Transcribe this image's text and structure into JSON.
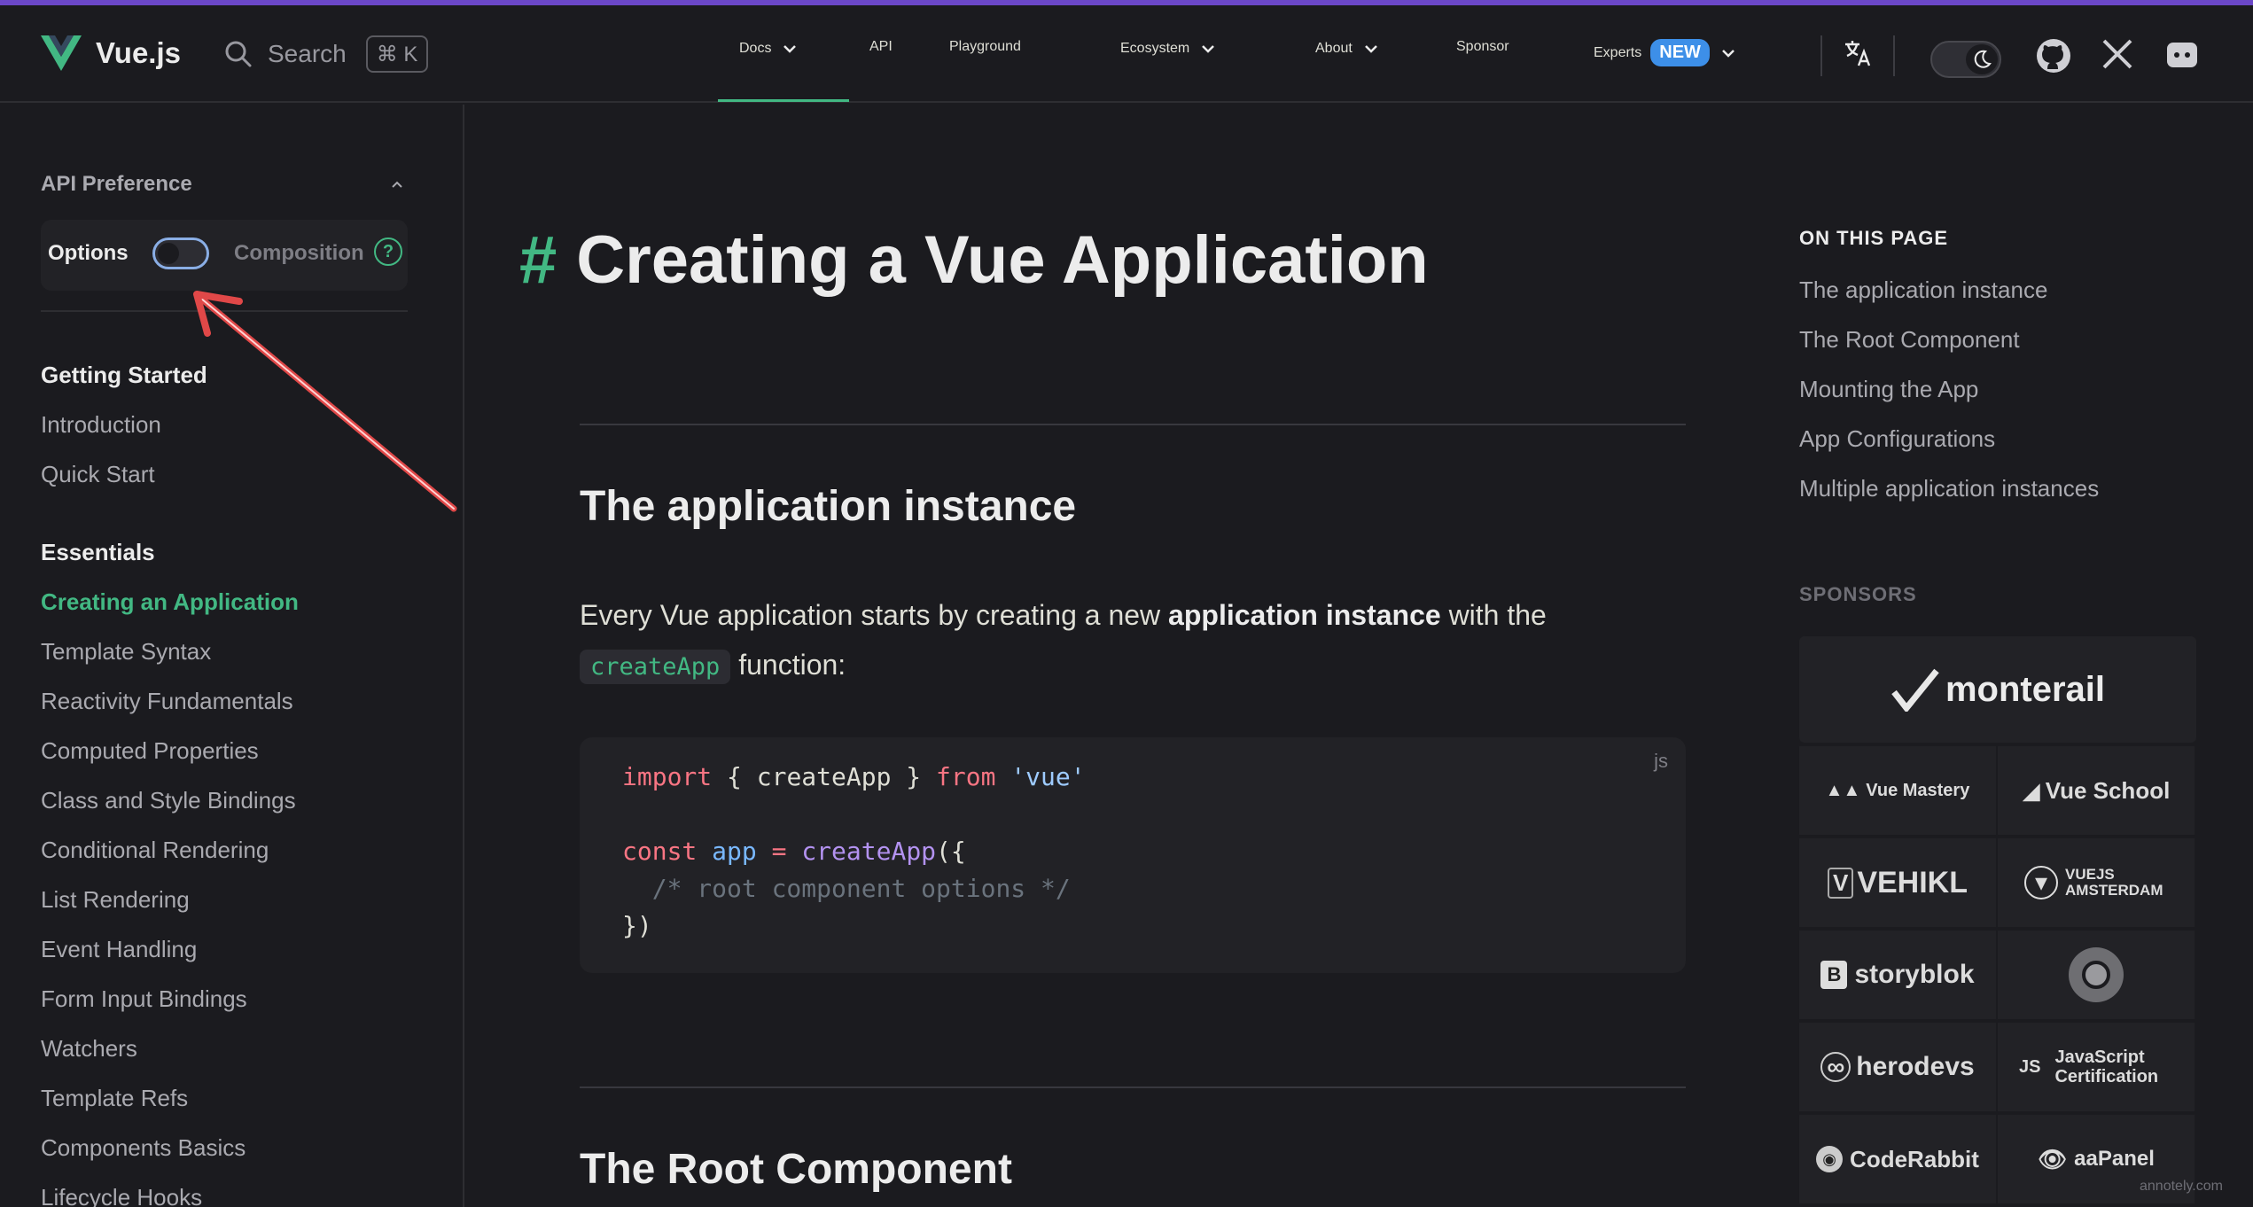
{
  "brand": {
    "name": "Vue.js",
    "accent": "#42b883",
    "top_line_color": "#6b47c8"
  },
  "search": {
    "label": "Search",
    "shortcut": "⌘ K"
  },
  "nav": {
    "docs": "Docs",
    "api": "API",
    "playground": "Playground",
    "ecosystem": "Ecosystem",
    "about": "About",
    "sponsor": "Sponsor",
    "experts": "Experts",
    "new_badge": "NEW"
  },
  "sidebar": {
    "api_preference": "API Preference",
    "options": "Options",
    "composition": "Composition",
    "help": "?",
    "sections": [
      {
        "title": "Getting Started",
        "items": [
          "Introduction",
          "Quick Start"
        ]
      },
      {
        "title": "Essentials",
        "items": [
          "Creating an Application",
          "Template Syntax",
          "Reactivity Fundamentals",
          "Computed Properties",
          "Class and Style Bindings",
          "Conditional Rendering",
          "List Rendering",
          "Event Handling",
          "Form Input Bindings",
          "Watchers",
          "Template Refs",
          "Components Basics",
          "Lifecycle Hooks"
        ]
      }
    ],
    "active_item": "Creating an Application"
  },
  "main": {
    "hash": "#",
    "title": "Creating a Vue Application",
    "section1_title": "The application instance",
    "para_pre": "Every Vue application starts by creating a new ",
    "para_bold": "application instance",
    "para_post": " with the",
    "inline_code": "createApp",
    "para_end": " function:",
    "code_lang": "js",
    "section2_title": "The Root Component"
  },
  "aside": {
    "on_this_page": "ON THIS PAGE",
    "links": [
      "The application instance",
      "The Root Component",
      "Mounting the App",
      "App Configurations",
      "Multiple application instances"
    ],
    "sponsors_title": "SPONSORS",
    "sponsors_big": "monterail",
    "sponsors": [
      "Vue Mastery",
      "Vue School",
      "VEHIKL",
      "VUEJS AMSTERDAM",
      "storyblok",
      "",
      "herodevs",
      "JavaScript Certification",
      "CodeRabbit",
      "aaPanel"
    ]
  },
  "watermark": "annotely.com"
}
